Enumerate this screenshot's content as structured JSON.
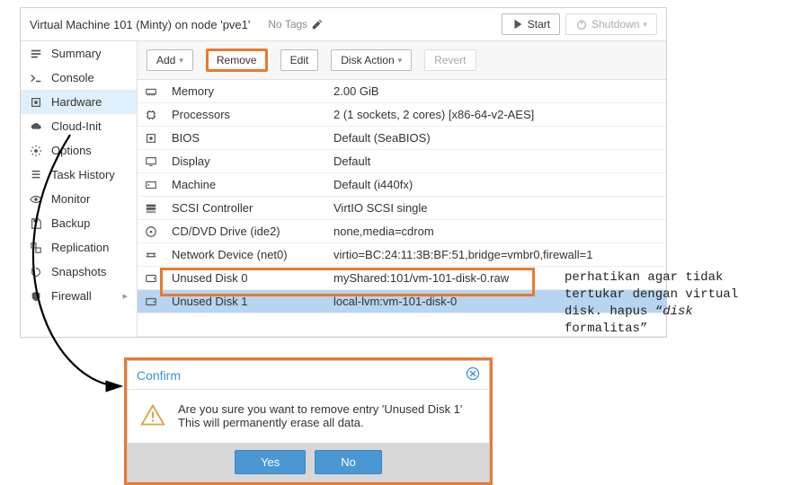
{
  "title": "Virtual Machine 101 (Minty) on node 'pve1'",
  "tags_label": "No Tags",
  "buttons": {
    "start": "Start",
    "shutdown": "Shutdown",
    "add": "Add",
    "remove": "Remove",
    "edit": "Edit",
    "disk_action": "Disk Action",
    "revert": "Revert"
  },
  "sidebar": [
    {
      "label": "Summary",
      "icon": "summary"
    },
    {
      "label": "Console",
      "icon": "console"
    },
    {
      "label": "Hardware",
      "icon": "hardware",
      "active": true
    },
    {
      "label": "Cloud-Init",
      "icon": "cloud"
    },
    {
      "label": "Options",
      "icon": "gear"
    },
    {
      "label": "Task History",
      "icon": "list"
    },
    {
      "label": "Monitor",
      "icon": "eye"
    },
    {
      "label": "Backup",
      "icon": "save"
    },
    {
      "label": "Replication",
      "icon": "repl"
    },
    {
      "label": "Snapshots",
      "icon": "history"
    },
    {
      "label": "Firewall",
      "icon": "shield",
      "sub": "▸"
    }
  ],
  "hardware": [
    {
      "icon": "memory",
      "k": "Memory",
      "v": "2.00 GiB"
    },
    {
      "icon": "cpu",
      "k": "Processors",
      "v": "2 (1 sockets, 2 cores) [x86-64-v2-AES]"
    },
    {
      "icon": "bios",
      "k": "BIOS",
      "v": "Default (SeaBIOS)"
    },
    {
      "icon": "display",
      "k": "Display",
      "v": "Default"
    },
    {
      "icon": "machine",
      "k": "Machine",
      "v": "Default (i440fx)"
    },
    {
      "icon": "scsi",
      "k": "SCSI Controller",
      "v": "VirtIO SCSI single"
    },
    {
      "icon": "cd",
      "k": "CD/DVD Drive (ide2)",
      "v": "none,media=cdrom"
    },
    {
      "icon": "net",
      "k": "Network Device (net0)",
      "v": "virtio=BC:24:11:3B:BF:51,bridge=vmbr0,firewall=1"
    },
    {
      "icon": "disk",
      "k": "Unused Disk 0",
      "v": "myShared:101/vm-101-disk-0.raw"
    },
    {
      "icon": "disk",
      "k": "Unused Disk 1",
      "v": "local-lvm:vm-101-disk-0",
      "sel": true
    }
  ],
  "dialog": {
    "title": "Confirm",
    "line1": "Are you sure you want to remove entry 'Unused Disk 1'",
    "line2": "This will permanently erase all data.",
    "yes": "Yes",
    "no": "No"
  },
  "annotation": {
    "t1": "perhatikan agar tidak",
    "t2": "tertukar dengan virtual",
    "t3": "disk. hapus “",
    "t3i": "disk",
    "t4": "formalitas",
    "t4b": "”"
  }
}
